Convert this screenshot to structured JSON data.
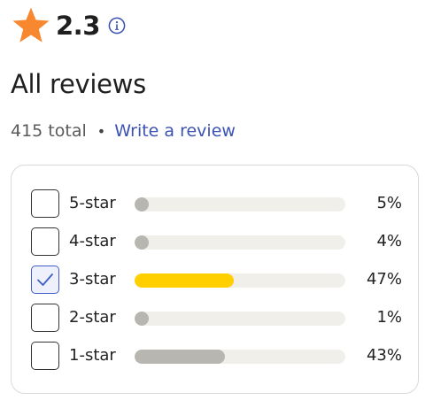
{
  "rating": {
    "value": "2.3",
    "icon": "star-icon",
    "info_icon": "info-icon",
    "star_color": "#f7882f"
  },
  "reviews": {
    "heading": "All reviews",
    "total": "415 total",
    "separator": "•",
    "write_link": "Write a review",
    "link_color": "#3b52b4"
  },
  "filters": [
    {
      "label": "5-star",
      "percent_text": "5%",
      "percent": 5,
      "checked": false
    },
    {
      "label": "4-star",
      "percent_text": "4%",
      "percent": 4,
      "checked": false
    },
    {
      "label": "3-star",
      "percent_text": "47%",
      "percent": 47,
      "checked": true
    },
    {
      "label": "2-star",
      "percent_text": "1%",
      "percent": 1,
      "checked": false
    },
    {
      "label": "1-star",
      "percent_text": "43%",
      "percent": 43,
      "checked": false
    }
  ],
  "colors": {
    "bar_default": "#b8b6b0",
    "bar_selected": "#ffcf00",
    "bar_track": "#f1efea",
    "checkbox_selected": "#3f5dc6"
  }
}
